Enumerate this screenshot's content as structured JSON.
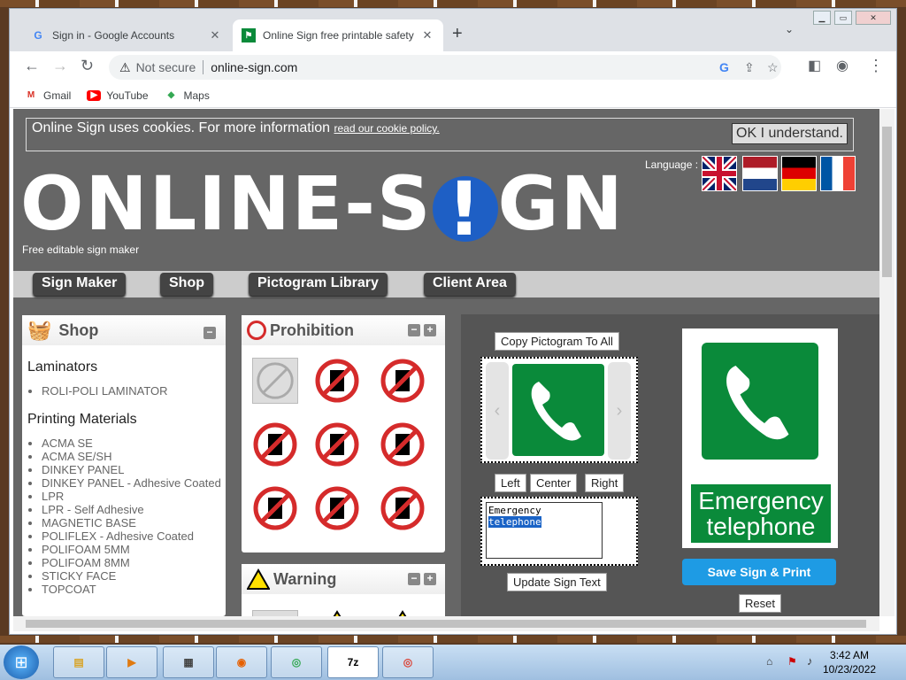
{
  "browser": {
    "tabs": [
      {
        "title": "Sign in - Google Accounts",
        "icon": "google-g-icon"
      },
      {
        "title": "Online Sign free printable safety",
        "icon": "online-sign-favicon"
      }
    ],
    "address": {
      "security_label": "Not secure",
      "url": "online-sign.com"
    },
    "bookmarks": [
      {
        "label": "Gmail",
        "icon": "gmail-icon"
      },
      {
        "label": "YouTube",
        "icon": "youtube-icon"
      },
      {
        "label": "Maps",
        "icon": "maps-icon"
      }
    ]
  },
  "cookie_banner": {
    "text": "Online Sign uses cookies. For more information",
    "link": "read our cookie policy.",
    "button": "OK I understand."
  },
  "header": {
    "logo_left": "ONLINE-S",
    "logo_bang": "!",
    "logo_right": "GN",
    "tagline": "Free editable sign maker",
    "language_label": "Language :",
    "flags": [
      "uk-flag",
      "netherlands-flag",
      "germany-flag",
      "france-flag"
    ]
  },
  "nav": [
    "Sign Maker",
    "Shop",
    "Pictogram Library",
    "Client Area"
  ],
  "shop": {
    "title": "Shop",
    "sections": [
      {
        "heading": "Laminators",
        "items": [
          "ROLI-POLI LAMINATOR"
        ]
      },
      {
        "heading": "Printing Materials",
        "items": [
          "ACMA SE",
          "ACMA SE/SH",
          "DINKEY PANEL",
          "DINKEY PANEL - Adhesive Coated",
          "LPR",
          "LPR - Self Adhesive",
          "MAGNETIC BASE",
          "POLIFLEX - Adhesive Coated",
          "POLIFOAM 5MM",
          "POLIFOAM 8MM",
          "STICKY FACE",
          "TOPCOAT"
        ]
      }
    ]
  },
  "prohibition": {
    "title": "Prohibition",
    "plus": "+",
    "minus": "−"
  },
  "warning": {
    "title": "Warning",
    "plus": "+",
    "minus": "−"
  },
  "editor": {
    "copy_btn": "Copy Pictogram To All",
    "align": [
      "Left",
      "Center",
      "Right"
    ],
    "text_line1": "Emergency",
    "text_line2": "telephone",
    "update_btn": "Update Sign Text",
    "preview_line1": "Emergency",
    "preview_line2": "telephone",
    "save_btn": "Save Sign & Print",
    "reset_btn": "Reset",
    "sign_color": "#0a8a3a"
  },
  "taskbar": {
    "time": "3:42 AM",
    "date": "10/23/2022",
    "apps": [
      "explorer-icon",
      "media-player-icon",
      "control-panel-icon",
      "firefox-icon",
      "chrome-icon",
      "7zip-icon",
      "chrome-alt-icon"
    ]
  }
}
